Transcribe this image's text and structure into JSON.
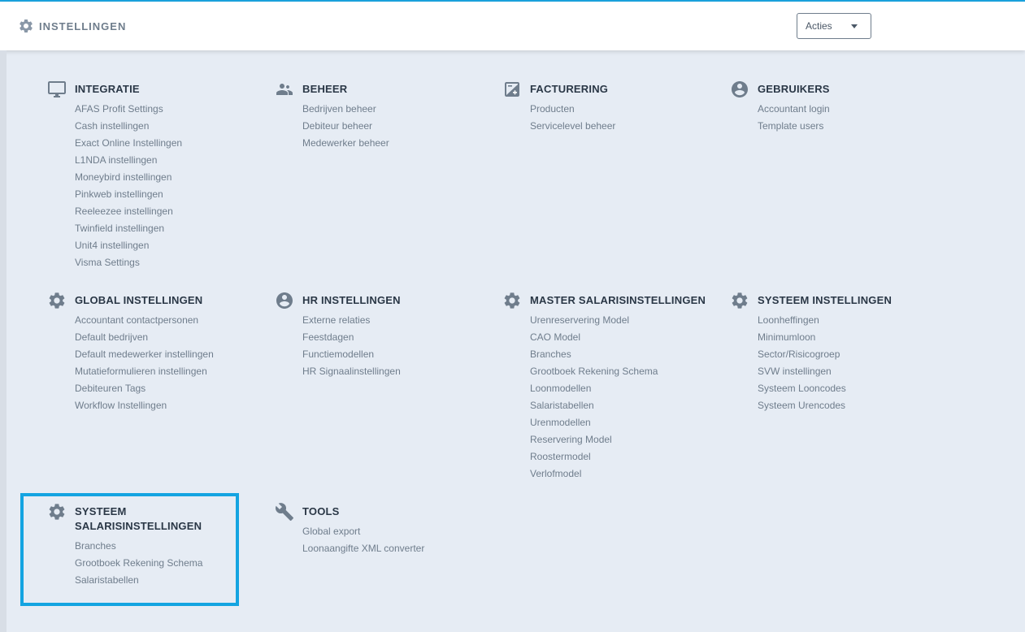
{
  "header": {
    "title": "INSTELLINGEN",
    "acties_label": "Acties"
  },
  "sections": {
    "integratie": {
      "title": "INTEGRATIE",
      "icon": "monitor-icon",
      "items": [
        "AFAS Profit Settings",
        "Cash instellingen",
        "Exact Online Instellingen",
        "L1NDA instellingen",
        "Moneybird instellingen",
        "Pinkweb instellingen",
        "Reeleezee instellingen",
        "Twinfield instellingen",
        "Unit4 instellingen",
        "Visma Settings"
      ]
    },
    "beheer": {
      "title": "BEHEER",
      "icon": "users-icon",
      "items": [
        "Bedrijven beheer",
        "Debiteur beheer",
        "Medewerker beheer"
      ]
    },
    "facturering": {
      "title": "FACTURERING",
      "icon": "invoice-icon",
      "items": [
        "Producten",
        "Servicelevel beheer"
      ]
    },
    "gebruikers": {
      "title": "GEBRUIKERS",
      "icon": "user-circle-icon",
      "items": [
        "Accountant login",
        "Template users"
      ]
    },
    "global": {
      "title": "GLOBAL INSTELLINGEN",
      "icon": "gear-icon",
      "items": [
        "Accountant contactpersonen",
        "Default bedrijven",
        "Default medewerker instellingen",
        "Mutatieformulieren instellingen",
        "Debiteuren Tags",
        "Workflow Instellingen"
      ]
    },
    "hr": {
      "title": "HR INSTELLINGEN",
      "icon": "user-circle-icon",
      "items": [
        "Externe relaties",
        "Feestdagen",
        "Functiemodellen",
        "HR Signaalinstellingen"
      ]
    },
    "master": {
      "title": "MASTER SALARISINSTELLINGEN",
      "icon": "gear-icon",
      "items": [
        "Urenreservering Model",
        "CAO Model",
        "Branches",
        "Grootboek Rekening Schema",
        "Loonmodellen",
        "Salaristabellen",
        "Urenmodellen",
        "Reservering Model",
        "Roostermodel",
        "Verlofmodel"
      ]
    },
    "systeem": {
      "title": "SYSTEEM INSTELLINGEN",
      "icon": "gear-icon",
      "items": [
        "Loonheffingen",
        "Minimumloon",
        "Sector/Risicogroep",
        "SVW instellingen",
        "Systeem Looncodes",
        "Systeem Urencodes"
      ]
    },
    "systeem_salaris": {
      "title": "SYSTEEM SALARISINSTELLINGEN",
      "icon": "gear-icon",
      "items": [
        "Branches",
        "Grootboek Rekening Schema",
        "Salaristabellen"
      ]
    },
    "tools": {
      "title": "TOOLS",
      "icon": "wrench-icon",
      "items": [
        "Global export",
        "Loonaangifte XML converter"
      ]
    }
  },
  "colors": {
    "accent": "#14a4e1",
    "background": "#e6ecf4",
    "icon": "#6f7d8c",
    "title": "#2a3746",
    "link": "#6f7d8c"
  }
}
